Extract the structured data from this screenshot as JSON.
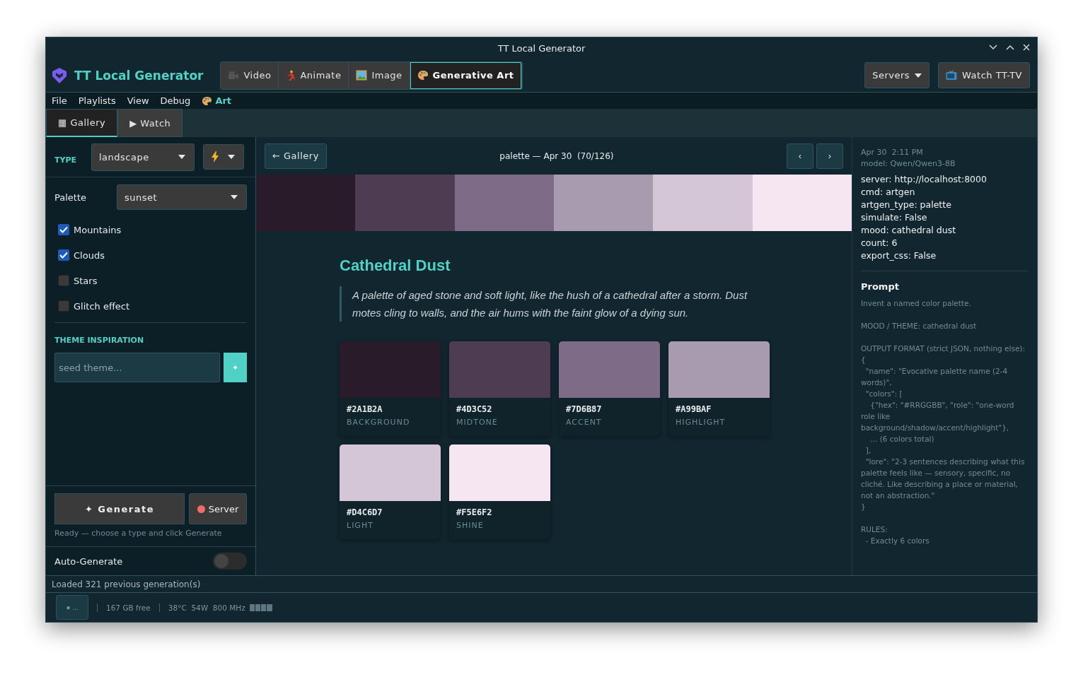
{
  "window": {
    "title": "TT Local Generator"
  },
  "header": {
    "brand": "TT Local Generator",
    "mode_tabs": [
      {
        "label": "Video",
        "selected": false
      },
      {
        "label": "Animate",
        "selected": false
      },
      {
        "label": "Image",
        "selected": false
      },
      {
        "label": "Generative Art",
        "selected": true
      }
    ],
    "servers_button": "Servers",
    "watch_button": "Watch TT-TV"
  },
  "menu": {
    "items": [
      "File",
      "Playlists",
      "View",
      "Debug"
    ],
    "art": "Art"
  },
  "view_tabs": [
    {
      "label": "▦ Gallery",
      "selected": true
    },
    {
      "label": "▶ Watch",
      "selected": false
    }
  ],
  "sidebar": {
    "type_label": "TYPE",
    "type_value": "landscape",
    "palette_label": "Palette",
    "palette_value": "sunset",
    "options": [
      {
        "label": "Mountains",
        "checked": true
      },
      {
        "label": "Clouds",
        "checked": true
      },
      {
        "label": "Stars",
        "checked": false
      },
      {
        "label": "Glitch effect",
        "checked": false
      }
    ],
    "theme_label": "THEME INSPIRATION",
    "theme_placeholder": "seed theme...",
    "seed_button": "✦",
    "generate_button": "✦ Generate",
    "server_button": {
      "label": "Server",
      "color": "#f26b6b"
    },
    "status": "Ready — choose a type and click Generate",
    "auto_generate": {
      "label": "Auto-Generate",
      "on": false
    }
  },
  "content": {
    "back_button": "← Gallery",
    "title": "palette — Apr 30  (70/126)",
    "prev": "‹",
    "next": "›",
    "palette_name": "Cathedral Dust",
    "lore": "A palette of aged stone and soft light, like the hush of a cathedral after a storm. Dust motes cling to walls, and the air hums with the faint glow of a dying sun.",
    "swatches": [
      {
        "hex": "#2A1B2A",
        "role": "BACKGROUND",
        "color": "#2a1b2a"
      },
      {
        "hex": "#4D3C52",
        "role": "MIDTONE",
        "color": "#4d3c52"
      },
      {
        "hex": "#7D6B87",
        "role": "ACCENT",
        "color": "#7d6b87"
      },
      {
        "hex": "#A99BAF",
        "role": "HIGHLIGHT",
        "color": "#a99baf"
      },
      {
        "hex": "#D4C6D7",
        "role": "LIGHT",
        "color": "#d4c6d7"
      },
      {
        "hex": "#F5E6F2",
        "role": "SHINE",
        "color": "#f5e6f2"
      }
    ]
  },
  "details": {
    "timestamp": "Apr 30  2:11 PM",
    "model": "model: Qwen/Qwen3-8B",
    "params": [
      "server: http://localhost:8000",
      "cmd: artgen",
      "artgen_type: palette",
      "simulate: False",
      "mood: cathedral dust",
      "count: 6",
      "export_css: False"
    ],
    "prompt_heading": "Prompt",
    "prompt": "Invent a named color palette.\n\nMOOD / THEME: cathedral dust\n\nOUTPUT FORMAT (strict JSON, nothing else):\n{\n  \"name\": \"Evocative palette name (2-4 words)\",\n  \"colors\": [\n    {\"hex\": \"#RRGGBB\", \"role\": \"one-word role like background/shadow/accent/highlight\"},\n    ... (6 colors total)\n  ],\n  \"lore\": \"2-3 sentences describing what this palette feels like — sensory, specific, no cliché. Like describing a place or material, not an abstraction.\"\n}\n\nRULES:\n  - Exactly 6 colors"
  },
  "status_line": "Loaded 321 previous generation(s)",
  "bottom_bar": {
    "activity_button": "● ...",
    "disk": "167 GB free",
    "stats": "38°C  54W  800 MHz"
  }
}
